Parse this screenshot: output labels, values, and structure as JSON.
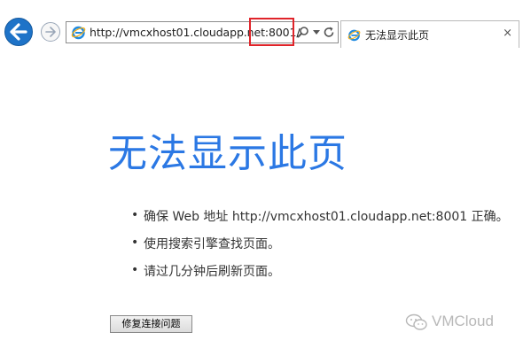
{
  "browser": {
    "url": "http://vmcxhost01.cloudapp.net:8001/",
    "tab_title": "无法显示此页",
    "tab_close": "×",
    "icons": [
      "back-arrow-icon",
      "forward-arrow-icon",
      "ie-logo-icon",
      "search-icon",
      "dropdown-arrow-icon",
      "refresh-icon",
      "close-icon"
    ]
  },
  "page": {
    "heading": "无法显示此页",
    "tips": [
      "确保 Web 地址 http://vmcxhost01.cloudapp.net:8001 正确。",
      "使用搜索引擎查找页面。",
      "请过几分钟后刷新页面。"
    ],
    "bullet": "•",
    "fix_button_label": "修复连接问题"
  },
  "watermark": {
    "text": "VMCloud"
  },
  "colors": {
    "heading": "#2b78e4",
    "back_button": "#1e73c8",
    "highlight_box": "#e0242a"
  }
}
